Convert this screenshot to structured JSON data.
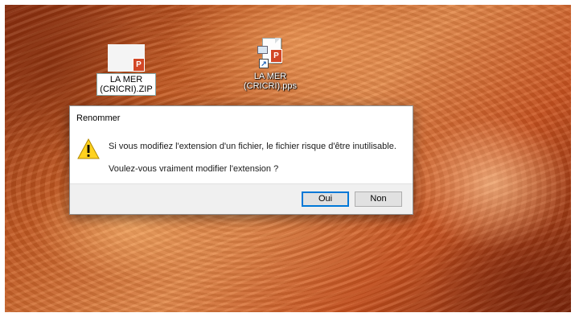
{
  "desktop": {
    "icons": [
      {
        "label_line1": "LA MER",
        "label_line2": "(CRICRI).ZIP",
        "badge": "P",
        "selected": true
      },
      {
        "label_line1": "LA MER",
        "label_line2": "(CRICRI).pps",
        "badge": "P",
        "selected": false
      }
    ]
  },
  "dialog": {
    "title": "Renommer",
    "message_line1": "Si vous modifiez l'extension d'un fichier, le fichier risque d'être inutilisable.",
    "message_line2": "Voulez-vous vraiment modifier l'extension ?",
    "icon": "warning-icon",
    "buttons": {
      "yes_label": "Oui",
      "no_label": "Non"
    },
    "accent_color": "#0078d7",
    "warning_color": "#ffd21f"
  }
}
